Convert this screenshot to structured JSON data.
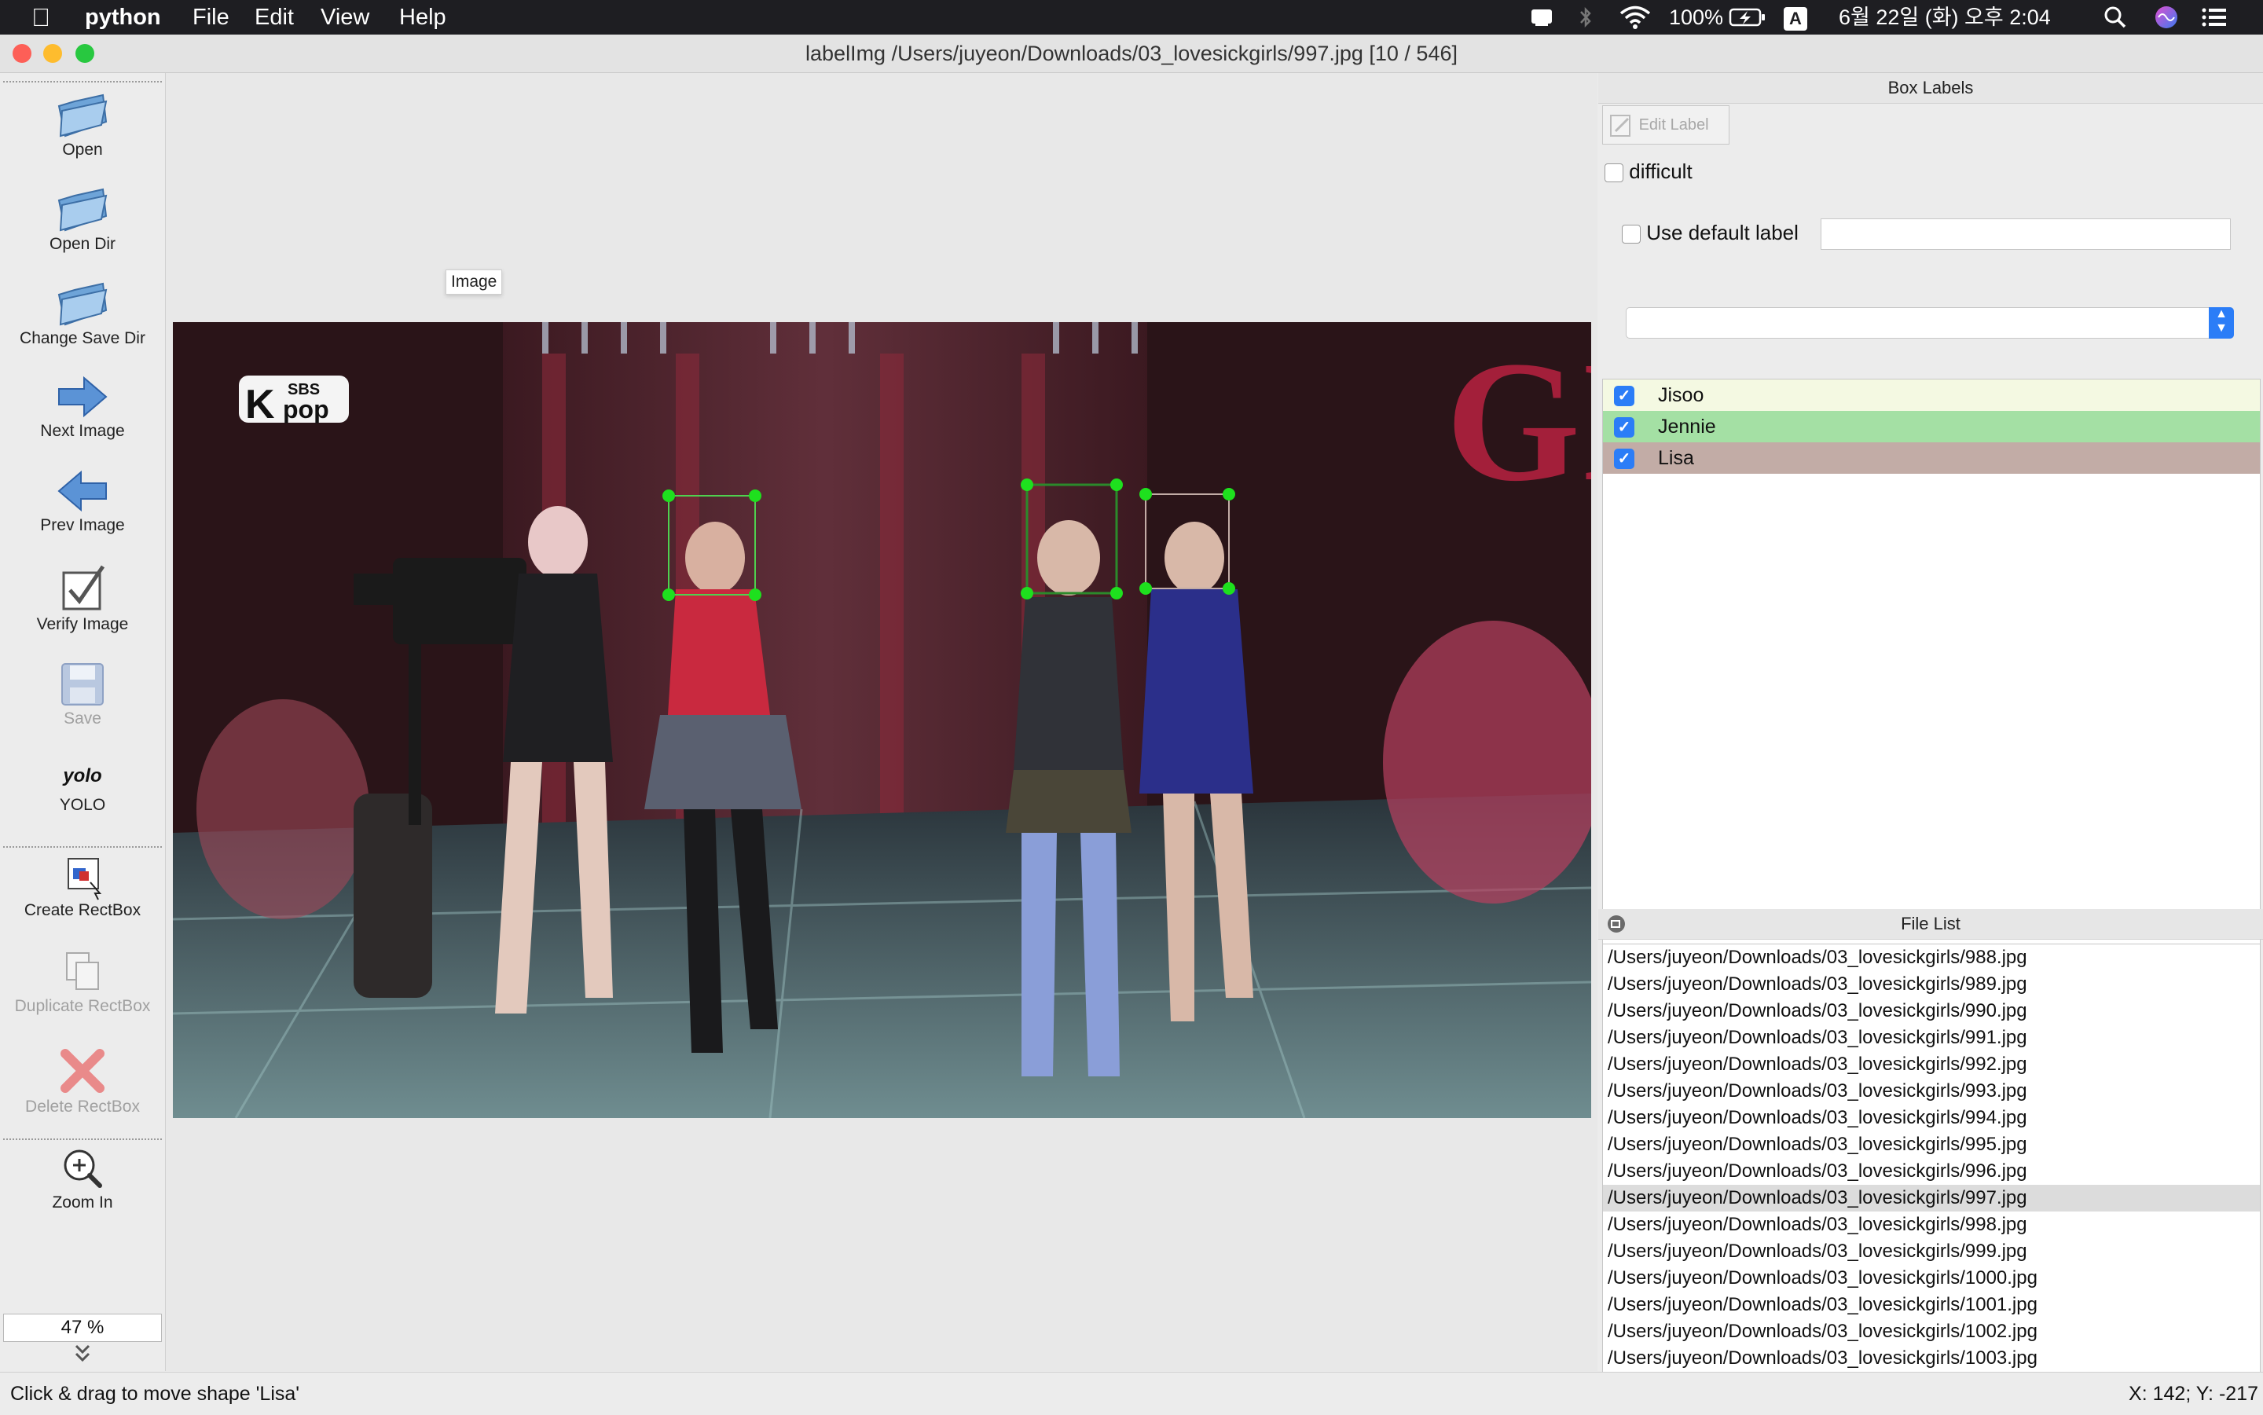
{
  "menubar": {
    "app": "python",
    "menus": [
      "File",
      "Edit",
      "View",
      "Help"
    ],
    "battery": "100%",
    "input_source": "A",
    "datetime": "6월 22일 (화) 오후 2:04"
  },
  "window": {
    "title": "labelImg /Users/juyeon/Downloads/03_lovesickgirls/997.jpg [10 / 546]"
  },
  "toolbar": {
    "open": "Open",
    "open_dir": "Open Dir",
    "change_save_dir": "Change Save Dir",
    "next_image": "Next Image",
    "prev_image": "Prev Image",
    "verify_image": "Verify Image",
    "save": "Save",
    "yolo_icon_text": "yolo",
    "yolo": "YOLO",
    "create_rectbox": "Create RectBox",
    "duplicate_rectbox": "Duplicate RectBox",
    "delete_rectbox": "Delete RectBox",
    "zoom_in": "Zoom In",
    "zoom_value": "47 %"
  },
  "canvas": {
    "tooltip": "Image",
    "photo_logo_top": "SBS",
    "photo_logo_bottom": "pop",
    "photo_logo_k": "K",
    "photo_sign": "GI"
  },
  "box_labels": {
    "header": "Box Labels",
    "edit_label": "Edit Label",
    "difficult": "difficult",
    "use_default_label": "Use default label",
    "default_label_value": "",
    "items": [
      {
        "label": "Jisoo",
        "checked": true,
        "color": "#f4f9e2"
      },
      {
        "label": "Jennie",
        "checked": true,
        "color": "#a4e0a4"
      },
      {
        "label": "Lisa",
        "checked": true,
        "color": "#c2aca6"
      }
    ]
  },
  "file_list": {
    "header": "File List",
    "selected": "/Users/juyeon/Downloads/03_lovesickgirls/997.jpg",
    "items": [
      "/Users/juyeon/Downloads/03_lovesickgirls/988.jpg",
      "/Users/juyeon/Downloads/03_lovesickgirls/989.jpg",
      "/Users/juyeon/Downloads/03_lovesickgirls/990.jpg",
      "/Users/juyeon/Downloads/03_lovesickgirls/991.jpg",
      "/Users/juyeon/Downloads/03_lovesickgirls/992.jpg",
      "/Users/juyeon/Downloads/03_lovesickgirls/993.jpg",
      "/Users/juyeon/Downloads/03_lovesickgirls/994.jpg",
      "/Users/juyeon/Downloads/03_lovesickgirls/995.jpg",
      "/Users/juyeon/Downloads/03_lovesickgirls/996.jpg",
      "/Users/juyeon/Downloads/03_lovesickgirls/997.jpg",
      "/Users/juyeon/Downloads/03_lovesickgirls/998.jpg",
      "/Users/juyeon/Downloads/03_lovesickgirls/999.jpg",
      "/Users/juyeon/Downloads/03_lovesickgirls/1000.jpg",
      "/Users/juyeon/Downloads/03_lovesickgirls/1001.jpg",
      "/Users/juyeon/Downloads/03_lovesickgirls/1002.jpg",
      "/Users/juyeon/Downloads/03_lovesickgirls/1003.jpg"
    ]
  },
  "status": {
    "message": "Click & drag to move shape 'Lisa'",
    "coords": "X: 142; Y: -217"
  }
}
